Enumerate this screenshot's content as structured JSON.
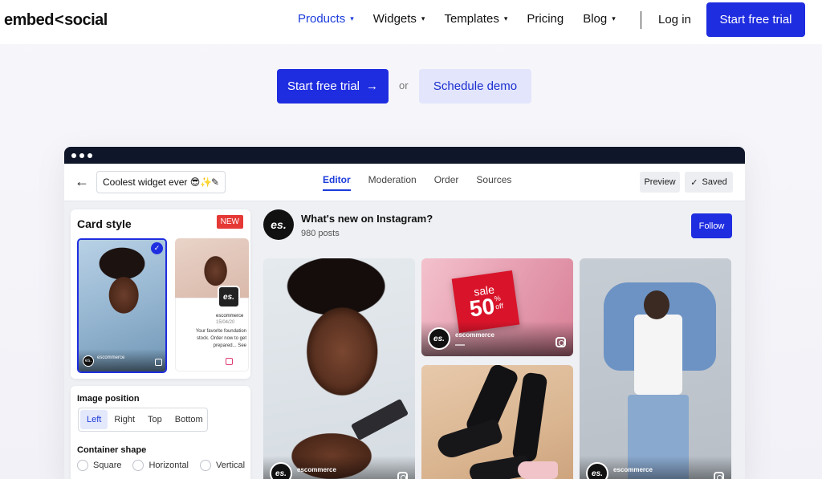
{
  "nav": {
    "logo_left": "embed",
    "logo_right": "ocial",
    "items": [
      {
        "label": "Products",
        "active": true,
        "has_dropdown": true
      },
      {
        "label": "Widgets",
        "active": false,
        "has_dropdown": true
      },
      {
        "label": "Templates",
        "active": false,
        "has_dropdown": true
      },
      {
        "label": "Pricing",
        "active": false,
        "has_dropdown": false
      },
      {
        "label": "Blog",
        "active": false,
        "has_dropdown": true
      }
    ],
    "login_label": "Log in",
    "cta_label": "Start free trial"
  },
  "hero": {
    "cta_label": "Start free trial",
    "cta_arrow": "→",
    "or_label": "or",
    "demo_label": "Schedule demo"
  },
  "editor": {
    "widget_name": "Coolest widget ever 😎✨",
    "tabs": [
      {
        "label": "Editor",
        "active": true
      },
      {
        "label": "Moderation",
        "active": false
      },
      {
        "label": "Order",
        "active": false
      },
      {
        "label": "Sources",
        "active": false
      }
    ],
    "preview_label": "Preview",
    "saved_label": "Saved"
  },
  "card_style": {
    "title": "Card style",
    "badge": "NEW",
    "option_a_handle": "escommerce",
    "option_b_handle": "escommerce",
    "option_b_date": "15/04/20",
    "option_b_text": "Your favorite foundation stock. Order now to get prepared... See"
  },
  "image_position": {
    "title": "Image position",
    "options": [
      {
        "label": "Left",
        "active": true
      },
      {
        "label": "Right",
        "active": false
      },
      {
        "label": "Top",
        "active": false
      },
      {
        "label": "Bottom",
        "active": false
      }
    ]
  },
  "container_shape": {
    "title": "Container shape",
    "options": [
      "Square",
      "Horizontal",
      "Vertical"
    ]
  },
  "feed": {
    "avatar_text": "es.",
    "title": "What's new on Instagram?",
    "posts_count": "980 posts",
    "follow_label": "Follow",
    "tiles": [
      {
        "handle": "escommerce"
      },
      {
        "handle": "escommerce",
        "sale_word": "sale",
        "sale_number": "50",
        "sale_suffix": "%",
        "sale_off": "off"
      },
      {
        "handle": ""
      },
      {
        "handle": "escommerce"
      }
    ]
  },
  "colors": {
    "primary": "#1f2de0",
    "primary_light": "#e2e5fb",
    "badge_red": "#e53935"
  }
}
